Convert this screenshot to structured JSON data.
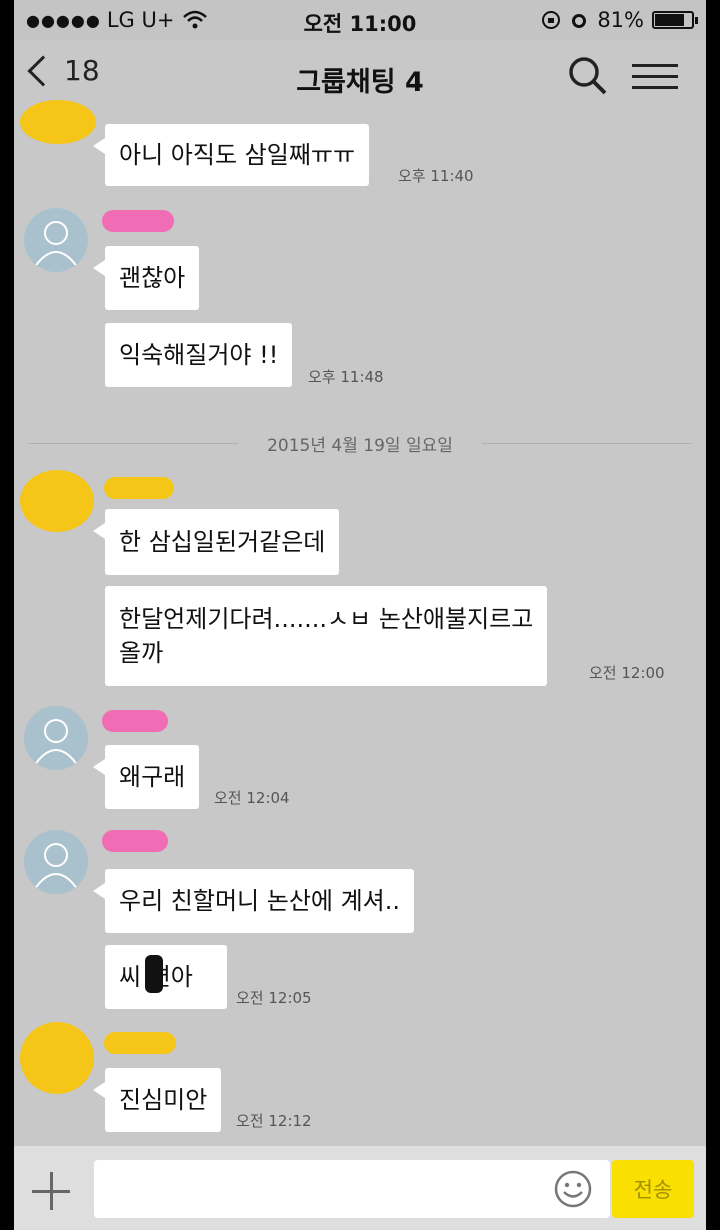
{
  "status_bar": {
    "carrier": "LG U+",
    "time": "오전 11:00",
    "battery": "81%",
    "battery_level": 0.81
  },
  "header": {
    "back_count": "18",
    "title": "그룹채팅 4"
  },
  "messages": [
    {
      "text": "아니 아직도 삼일째ㅠㅠ",
      "time": "오후 11:40"
    },
    {
      "text": "괜찮아",
      "time": ""
    },
    {
      "text": "익숙해질거야 !!",
      "time": "오후 11:48"
    },
    {
      "text": "한 삼십일된거같은데",
      "time": ""
    },
    {
      "text_line1": "한달언제기다려.......ㅅㅂ 논산애불지르고",
      "text_line2": "올까",
      "time": "오전 12:00"
    },
    {
      "text": "왜구래",
      "time": "오전 12:04"
    },
    {
      "text": "우리 친할머니 논산에 계셔..",
      "time": ""
    },
    {
      "text": "씨 련아",
      "time": "오전 12:05"
    },
    {
      "text": "진심미안",
      "time": "오전 12:12"
    }
  ],
  "date_divider": "2015년 4월 19일 일요일",
  "input_bar": {
    "placeholder": "",
    "send_label": "전송"
  },
  "colors": {
    "background": "#c8c8c8",
    "bubble": "#ffffff",
    "send_button": "#f9e000",
    "redaction_yellow": "#f5c518",
    "redaction_pink": "#f06cb4",
    "avatar": "#a9c1cc"
  },
  "icons": [
    "back-chevron-icon",
    "search-icon",
    "menu-icon",
    "wifi-icon",
    "alarm-icon",
    "battery-icon",
    "plus-icon",
    "emoji-icon"
  ]
}
